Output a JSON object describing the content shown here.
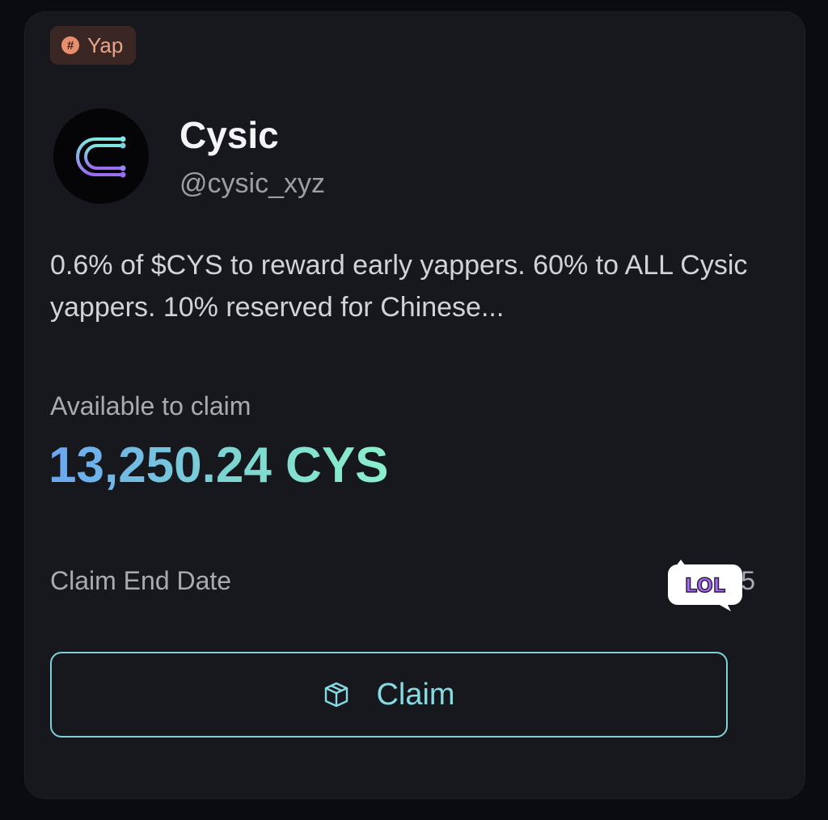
{
  "tag": {
    "icon": "hash-icon",
    "label": "Yap"
  },
  "project": {
    "name": "Cysic",
    "handle": "@cysic_xyz",
    "logo_icon": "cysic-logo-icon",
    "description": "0.6% of $CYS to reward early yappers. 60% to ALL Cysic yappers. 10% reserved for Chinese..."
  },
  "claim": {
    "available_label": "Available to claim",
    "amount": "13,250.24 CYS",
    "end_date_label": "Claim End Date",
    "end_date_value_partial": "5",
    "button_label": "Claim",
    "button_icon": "box-icon"
  },
  "sticker": {
    "text": "LOL"
  },
  "colors": {
    "background": "#0b0c10",
    "card": "#17181d",
    "tag_bg": "#3a2723",
    "tag_text": "#e8a48b",
    "accent_blue": "#6aa6f2",
    "accent_teal": "#8bf0cd",
    "button_border": "#7fd1d8"
  }
}
